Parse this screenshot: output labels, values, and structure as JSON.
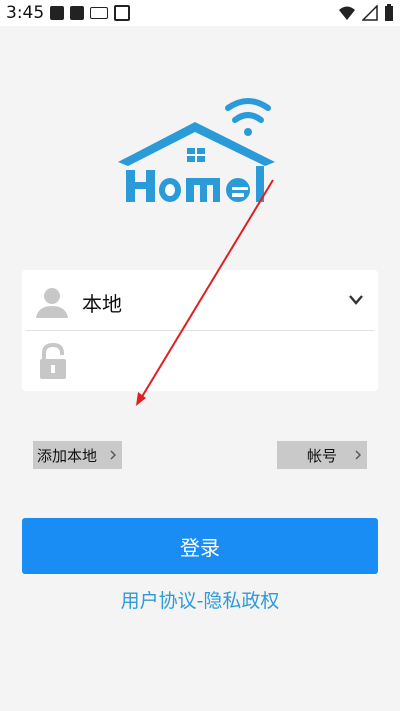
{
  "status_bar": {
    "time": "3:45"
  },
  "login_form": {
    "user_value": "本地",
    "password_value": ""
  },
  "actions": {
    "add_local_label": "添加本地",
    "account_label": "帐号",
    "login_label": "登录",
    "policy_label": "用户协议-隐私政权"
  },
  "colors": {
    "brand_blue": "#1a8df5",
    "logo_blue": "#2a9bd8",
    "link_blue": "#2f9bd8",
    "annotation_red": "#e02020"
  },
  "icons": [
    "user-icon",
    "lock-icon",
    "chevron-down-icon",
    "chevron-right-icon",
    "wifi-icon",
    "battery-icon"
  ]
}
